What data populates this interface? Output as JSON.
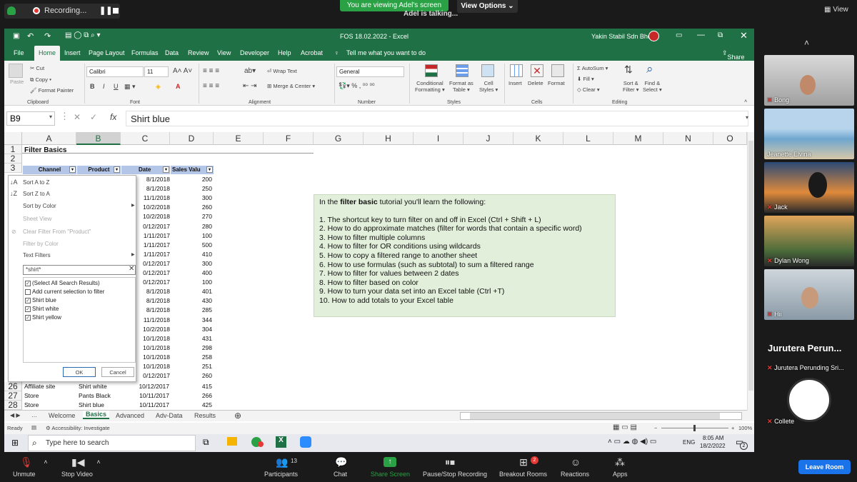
{
  "zoom": {
    "recording_label": "Recording...",
    "viewing_banner": "You are viewing Adel's screen",
    "view_options": "View Options",
    "talking": "Adel is talking...",
    "view_label": "View",
    "bottom": {
      "unmute": "Unmute",
      "stop_video": "Stop Video",
      "participants": "Participants",
      "participants_count": "13",
      "chat": "Chat",
      "share_screen": "Share Screen",
      "pause_recording": "Pause/Stop Recording",
      "breakout": "Breakout Rooms",
      "breakout_badge": "2",
      "reactions": "Reactions",
      "apps": "Apps",
      "leave": "Leave Room"
    },
    "participants": [
      {
        "name": "Bong"
      },
      {
        "name": "Jeanette Elvina"
      },
      {
        "name": "Jack"
      },
      {
        "name": "Dylan Wong"
      },
      {
        "name": "Hii"
      },
      {
        "name": "Jurutera Perun...",
        "sub": "Jurutera Perunding Sri..."
      },
      {
        "name": "Collete"
      }
    ]
  },
  "excel": {
    "title": "FOS 18.02.2022 - Excel",
    "title_app": "Excel",
    "company": "Yakin Stabil Sdn Bhd",
    "menu": [
      "File",
      "Home",
      "Insert",
      "Page Layout",
      "Formulas",
      "Data",
      "Review",
      "View",
      "Developer",
      "Help",
      "Acrobat"
    ],
    "tell_me": "Tell me what you want to do",
    "share": "Share",
    "ribbon": {
      "cut": "Cut",
      "copy": "Copy",
      "format_painter": "Format Painter",
      "paste": "Paste",
      "clipboard": "Clipboard",
      "font_name": "Calibri",
      "font_size": "11",
      "font": "Font",
      "wrap_text": "Wrap Text",
      "merge_center": "Merge & Center",
      "alignment": "Alignment",
      "number_format": "General",
      "number": "Number",
      "conditional": "Conditional",
      "formatting": "Formatting",
      "format_as": "Format as",
      "table": "Table",
      "cell": "Cell",
      "styles_btn": "Styles",
      "styles": "Styles",
      "insert": "Insert",
      "delete": "Delete",
      "format": "Format",
      "cells": "Cells",
      "autosum": "AutoSum",
      "fill": "Fill",
      "clear": "Clear",
      "sort_filter": "Sort &",
      "filter": "Filter",
      "find_select": "Find &",
      "select": "Select",
      "editing": "Editing"
    },
    "name_box": "B9",
    "formula": "Shirt blue",
    "columns": [
      "A",
      "B",
      "C",
      "D",
      "E",
      "F",
      "G",
      "H",
      "I",
      "J",
      "K",
      "L",
      "M",
      "N",
      "O"
    ],
    "sheet_title": "Filter Basics",
    "headers": [
      "Channel",
      "Product",
      "Date",
      "Sales Valu"
    ],
    "dates": [
      "8/1/2018",
      "8/1/2018",
      "11/1/2018",
      "10/2/2018",
      "10/2/2018",
      "0/12/2017",
      "1/11/2017",
      "1/11/2017",
      "1/11/2017",
      "0/12/2017",
      "0/12/2017",
      "0/12/2017",
      "8/1/2018",
      "8/1/2018",
      "8/1/2018",
      "11/1/2018",
      "10/2/2018",
      "10/1/2018",
      "10/1/2018",
      "10/1/2018",
      "10/1/2018",
      "0/12/2017"
    ],
    "sales": [
      "200",
      "250",
      "300",
      "260",
      "270",
      "280",
      "100",
      "500",
      "410",
      "300",
      "400",
      "100",
      "401",
      "430",
      "285",
      "344",
      "304",
      "431",
      "298",
      "258",
      "251",
      "260"
    ],
    "rows_bottom": [
      {
        "num": "26",
        "channel": "Affiliate site",
        "product": "Shirt white",
        "date": "10/12/2017",
        "sales": "415"
      },
      {
        "num": "27",
        "channel": "Store",
        "product": "Pants Black",
        "date": "10/11/2017",
        "sales": "266"
      },
      {
        "num": "28",
        "channel": "Store",
        "product": "Shirt blue",
        "date": "10/11/2017",
        "sales": "425"
      }
    ],
    "filter_panel": {
      "sort_az": "Sort A to Z",
      "sort_za": "Sort Z to A",
      "sort_color": "Sort by Color",
      "sheet_view": "Sheet View",
      "clear_filter": "Clear Filter From \"Product\"",
      "filter_color": "Filter by Color",
      "text_filters": "Text Filters",
      "search": "*shirt*",
      "items": [
        "(Select All Search Results)",
        "Add current selection to filter",
        "Shirt blue",
        "Shirt white",
        "Shirt yellow"
      ],
      "ok": "OK",
      "cancel": "Cancel"
    },
    "tutorial": {
      "intro_pre": "In the ",
      "intro_bold": "filter basic",
      "intro_post": " tutorial you'll learn the following:",
      "items": [
        "1. The shortcut key to turn filter on and off in Excel (Ctrl + Shift + L)",
        "2. How to do approximate matches (filter for words that contain a specific word)",
        "3. How to filter multiple columns",
        "4. How to filter for OR conditions using wildcards",
        "5. How to copy a filtered range to another sheet",
        "6. How to use formulas (such as subtotal) to sum a filtered range",
        "7. How to filter for values between 2 dates",
        "8. How to filter based on color",
        "9. How to turn your data set into an Excel table (Ctrl +T)",
        "10. How to add totals to your Excel table"
      ]
    },
    "sheets": [
      "Welcome",
      "Basics",
      "Advanced",
      "Adv-Data",
      "Results"
    ],
    "status_ready": "Ready",
    "accessibility": "Accessibility: Investigate",
    "zoom_level": "100%"
  },
  "taskbar": {
    "search_placeholder": "Type here to search",
    "lang": "ENG",
    "time": "8:05 AM",
    "date": "18/2/2022",
    "notif": "2"
  }
}
